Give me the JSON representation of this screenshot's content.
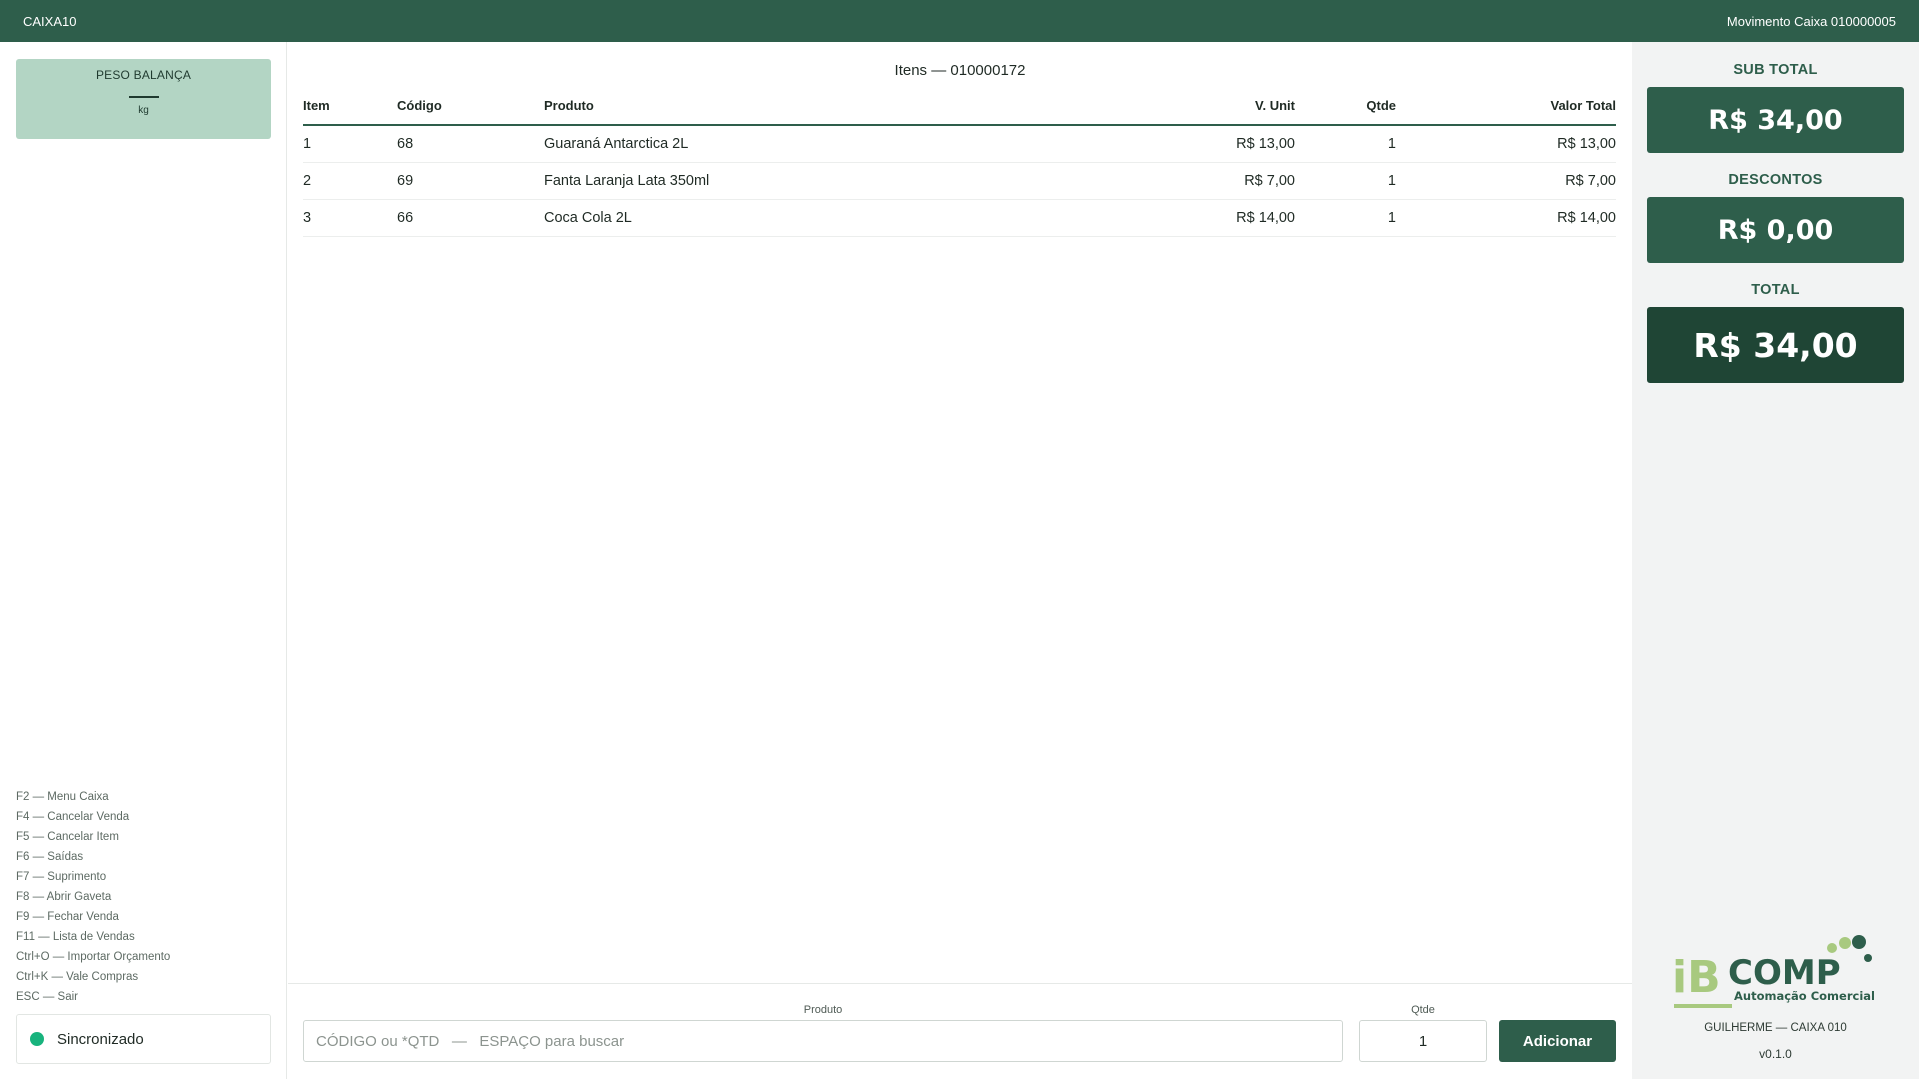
{
  "topbar": {
    "title": "CAIXA10",
    "movement": "Movimento Caixa 010000005"
  },
  "scale": {
    "label": "PESO BALANÇA",
    "value": "",
    "unit": "kg"
  },
  "shortcuts": [
    "F2 — Menu Caixa",
    "F4 — Cancelar Venda",
    "F5 — Cancelar Item",
    "F6 — Saídas",
    "F7 — Suprimento",
    "F8 — Abrir Gaveta",
    "F9 — Fechar Venda",
    "F11 — Lista de Vendas",
    "Ctrl+O — Importar Orçamento",
    "Ctrl+K — Vale Compras",
    "ESC — Sair"
  ],
  "sync": {
    "label": "Sincronizado",
    "color": "#18b37d"
  },
  "items": {
    "title": "Itens — 010000172",
    "columns": [
      "Item",
      "Código",
      "Produto",
      "V. Unit",
      "Qtde",
      "Valor Total"
    ],
    "rows": [
      [
        "1",
        "68",
        "Guaraná Antarctica 2L",
        "R$ 13,00",
        "1",
        "R$ 13,00"
      ],
      [
        "2",
        "69",
        "Fanta Laranja Lata 350ml",
        "R$ 7,00",
        "1",
        "R$ 7,00"
      ],
      [
        "3",
        "66",
        "Coca Cola 2L",
        "R$ 14,00",
        "1",
        "R$ 14,00"
      ]
    ]
  },
  "entry": {
    "product_label": "Produto",
    "product_placeholder": "CÓDIGO ou *QTD   —   ESPAÇO para buscar",
    "qty_label": "Qtde",
    "qty_value": "1",
    "add_label": "Adicionar"
  },
  "totals": {
    "subtotal_label": "SUB TOTAL",
    "subtotal_value": "R$ 34,00",
    "discounts_label": "DESCONTOS",
    "discounts_value": "R$ 0,00",
    "total_label": "TOTAL",
    "total_value": "R$ 34,00"
  },
  "brand": {
    "logo_text": "iBCOMP",
    "tagline": "Automação Comercial",
    "primary_color": "#2e5e4b",
    "accent_color": "#a8c97f"
  },
  "footer": {
    "user": "GUILHERME — CAIXA 010",
    "version": "v0.1.0"
  }
}
